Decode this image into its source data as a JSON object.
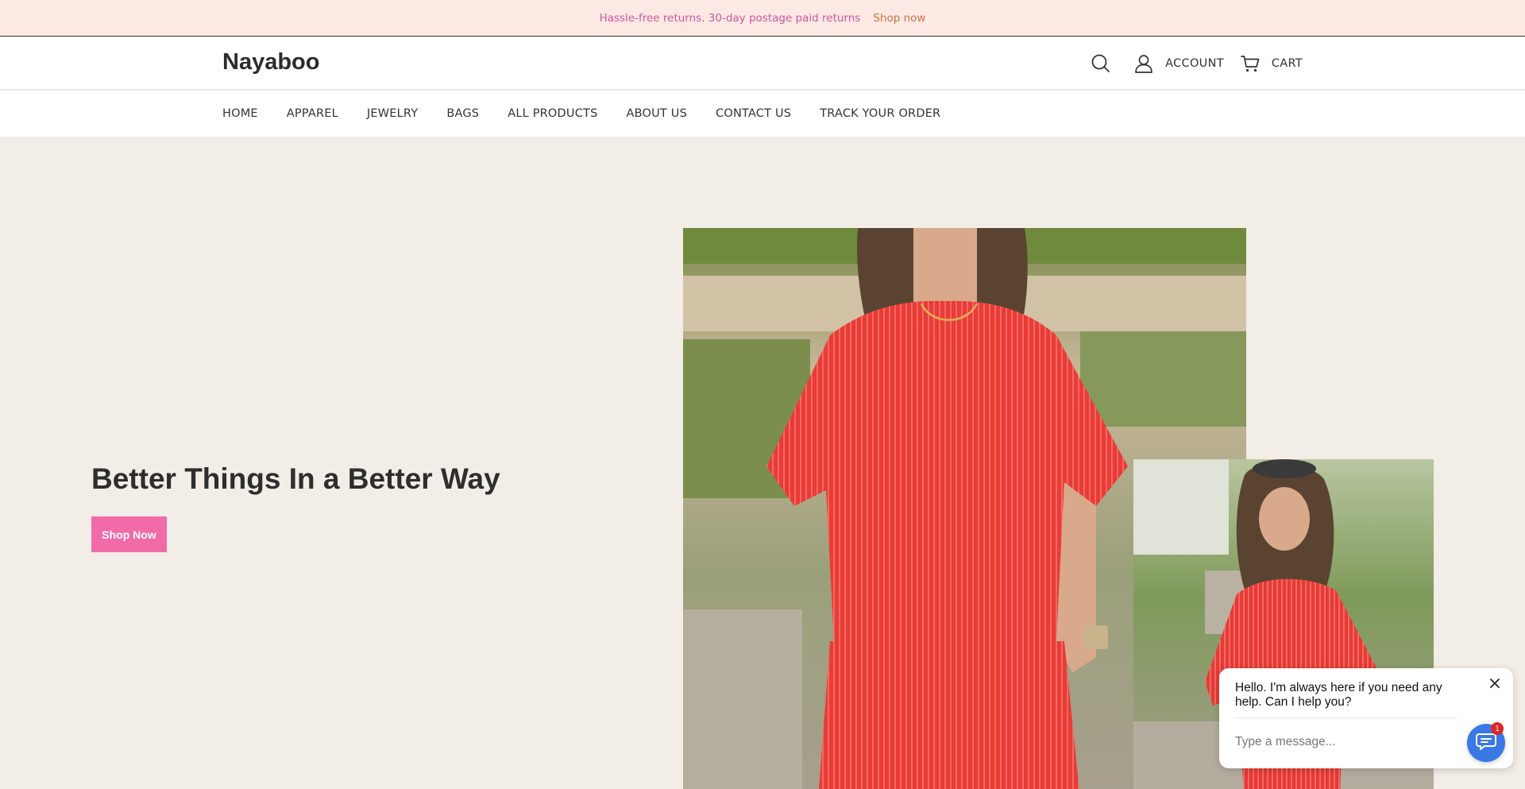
{
  "announcement": {
    "message": "Hassle-free returns. 30-day postage paid returns",
    "link": "Shop now"
  },
  "header": {
    "logo": "Nayaboo",
    "account_label": "ACCOUNT",
    "cart_label": "CART",
    "icons": [
      "search-icon",
      "account-icon",
      "cart-icon"
    ]
  },
  "nav": {
    "items": [
      "HOME",
      "APPAREL",
      "JEWELRY",
      "BAGS",
      "ALL PRODUCTS",
      "ABOUT US",
      "CONTACT US",
      "TRACK YOUR ORDER"
    ]
  },
  "hero": {
    "headline": "Better Things In a Better Way",
    "button": "Shop Now"
  },
  "chat": {
    "greeting": "Hello. I'm always here if you need any help. Can I help you?",
    "placeholder": "Type a message...",
    "badge": "1"
  },
  "colors": {
    "announcement_bg": "#fde9e4",
    "announcement_text": "#d0569a",
    "announcement_link": "#d0703a",
    "hero_bg": "#f2ede6",
    "button": "#f06ba8",
    "chat_fab": "#3a78e6",
    "badge": "#e02424"
  }
}
